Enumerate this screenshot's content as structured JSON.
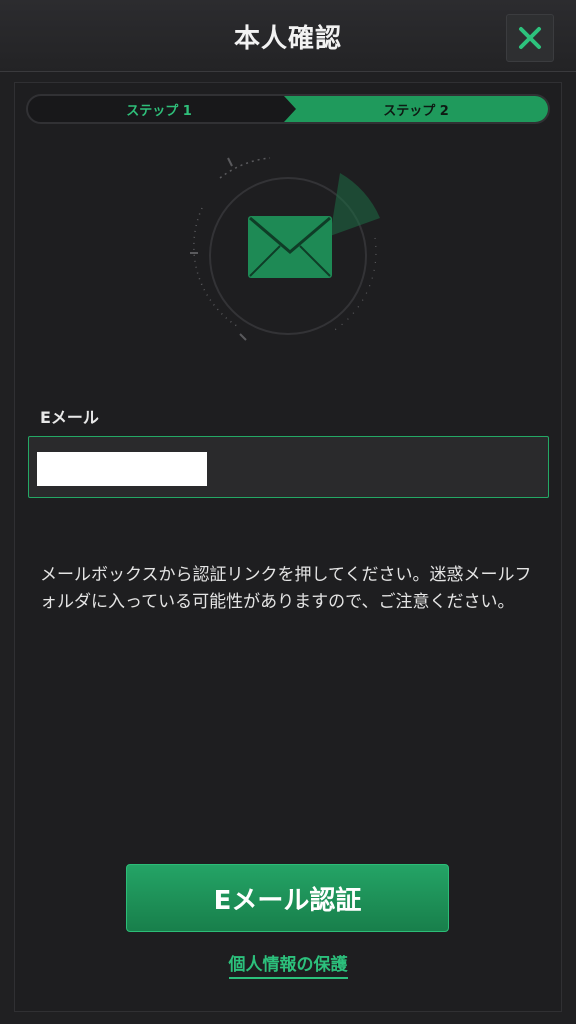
{
  "header": {
    "title": "本人確認",
    "close_icon": "close-icon"
  },
  "steps": {
    "step1_label": "ステップ 1",
    "step2_label": "ステップ 2",
    "active": 2
  },
  "emblem": {
    "icon": "envelope-icon"
  },
  "form": {
    "email_label": "Eメール",
    "email_value": ""
  },
  "notice": {
    "text": "メールボックスから認証リンクを押してください。迷惑メールフォルダに入っている可能性がありますので、ご注意ください。"
  },
  "actions": {
    "verify_label": "Eメール認証",
    "privacy_label": "個人情報の保護"
  },
  "colors": {
    "accent": "#1f9a5c",
    "accent_text": "#2cc07c",
    "background": "#1e1e20"
  }
}
